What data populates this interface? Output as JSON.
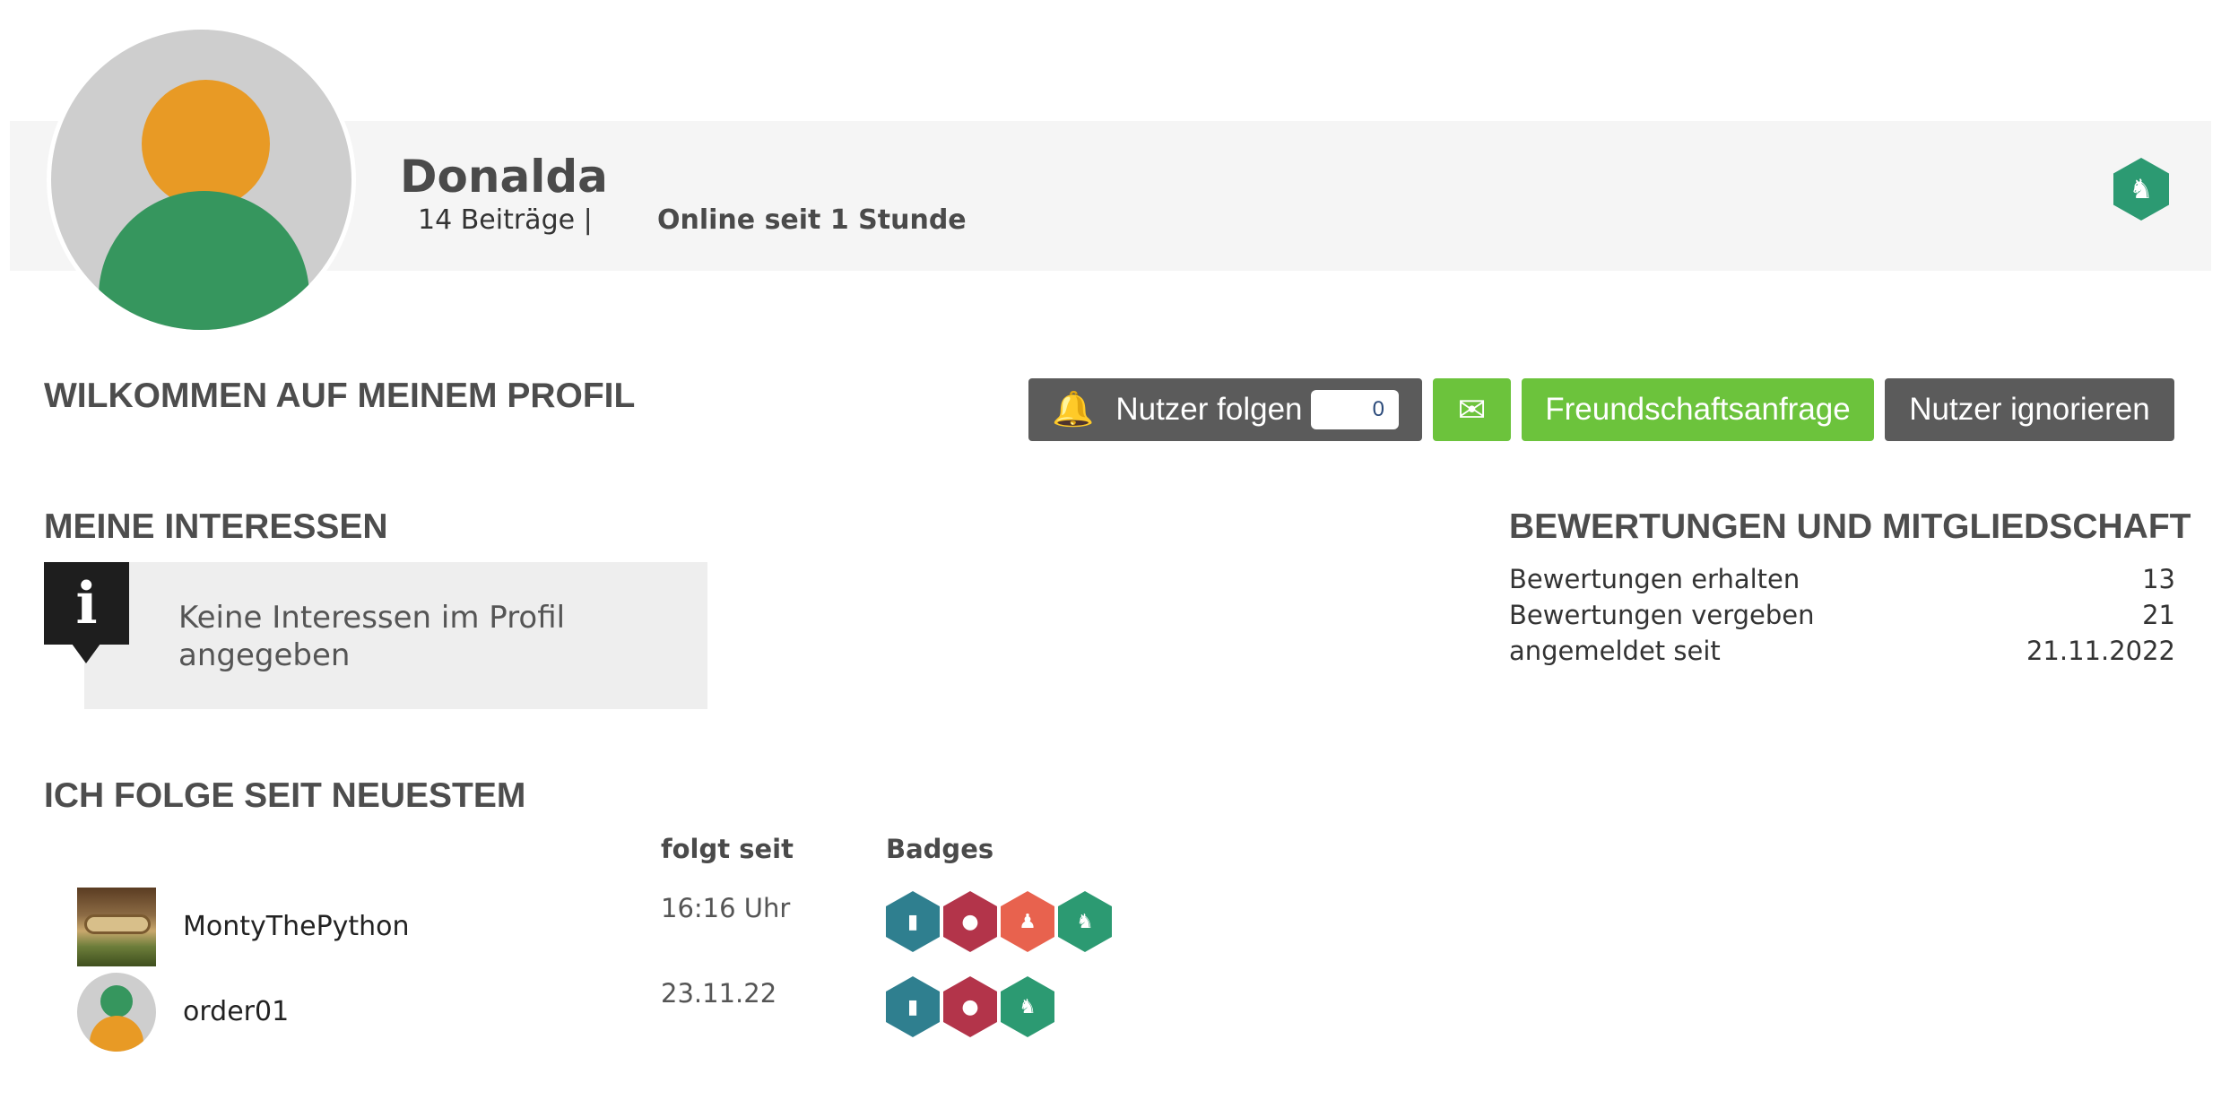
{
  "profile": {
    "name": "Donalda",
    "posts": "14 Beiträge |",
    "online": "Online seit 1 Stunde",
    "rank_badge_icon": "bull-icon",
    "avatar_colors": {
      "background": "#cecece",
      "head": "#e89a25",
      "body": "#36965e"
    }
  },
  "welcome": {
    "title": "WILKOMMEN AUF MEINEM PROFIL"
  },
  "actions": {
    "follow_label": "Nutzer folgen",
    "follow_count": "0",
    "mail_icon": "envelope-icon",
    "friend_label": "Freundschaftsanfrage",
    "ignore_label": "Nutzer ignorieren",
    "colors": {
      "dark": "#5b5b5b",
      "green": "#6cc33c"
    }
  },
  "interests": {
    "title": "MEINE INTERESSEN",
    "empty_text": "Keine Interessen im Profil angegeben",
    "icon_letter": "i"
  },
  "ratings": {
    "title": "BEWERTUNGEN UND MITGLIEDSCHAFT",
    "rows": [
      {
        "label": "Bewertungen erhalten",
        "value": "13"
      },
      {
        "label": "Bewertungen vergeben",
        "value": "21"
      },
      {
        "label": "angemeldet seit",
        "value": "21.11.2022"
      }
    ]
  },
  "following": {
    "title": "ICH FOLGE SEIT NEUESTEM",
    "col_since": "folgt seit",
    "col_badges": "Badges",
    "rows": [
      {
        "name": "MontyThePython",
        "since": "16:16 Uhr",
        "badges": [
          {
            "icon": "bar-chart-icon",
            "color": "#2f7f8f"
          },
          {
            "icon": "piggy-bank-icon",
            "color": "#b3344a"
          },
          {
            "icon": "group-icon",
            "color": "#e8624e"
          },
          {
            "icon": "bull-icon",
            "color": "#2c9a72"
          }
        ]
      },
      {
        "name": "order01",
        "since": "23.11.22",
        "badges": [
          {
            "icon": "bar-chart-icon",
            "color": "#2f7f8f"
          },
          {
            "icon": "piggy-bank-icon",
            "color": "#b3344a"
          },
          {
            "icon": "bull-icon",
            "color": "#2c9a72"
          }
        ]
      }
    ]
  }
}
